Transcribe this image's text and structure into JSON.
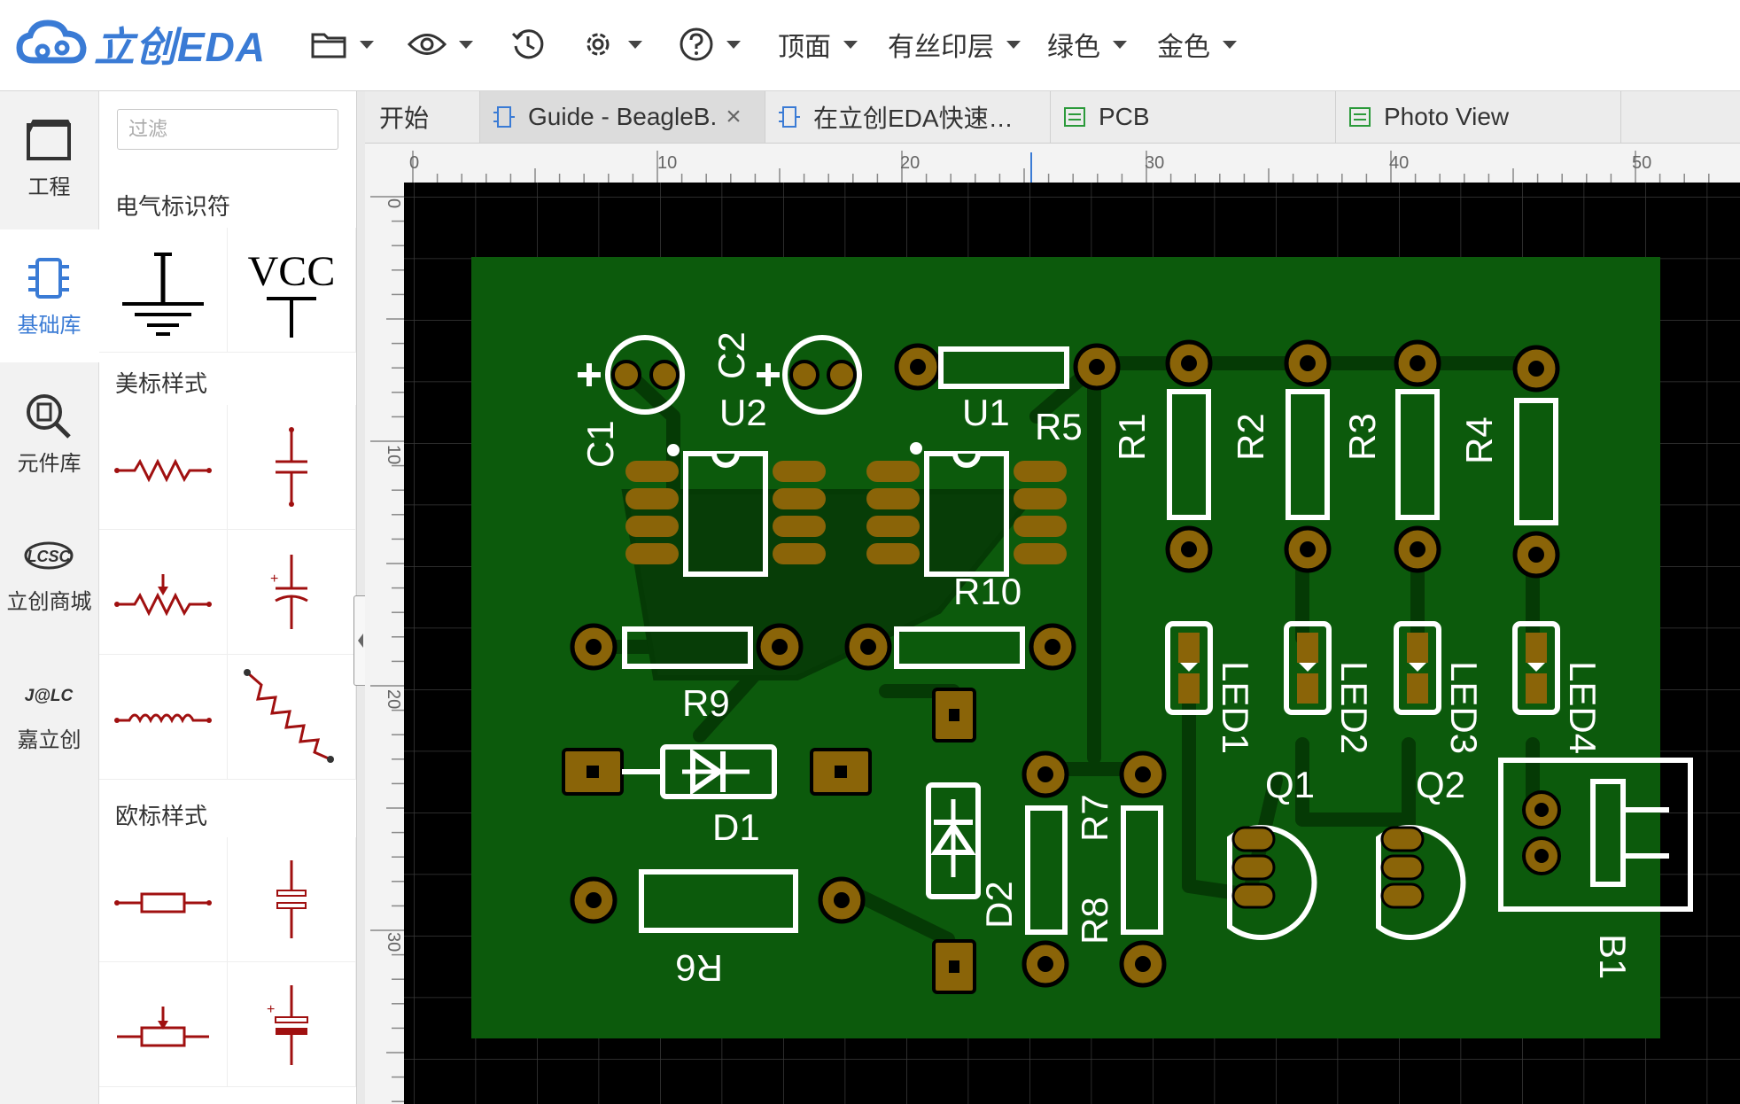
{
  "app": {
    "logo_text": "立创EDA"
  },
  "toolbar": {
    "icons": [
      "folder-icon",
      "eye-icon",
      "history-icon",
      "gear-icon",
      "help-icon"
    ],
    "layer_label": "顶面",
    "silk_label": "有丝印层",
    "board_color_label": "绿色",
    "finish_color_label": "金色"
  },
  "leftnav": {
    "items": [
      {
        "label": "工程",
        "icon": "project-icon"
      },
      {
        "label": "基础库",
        "icon": "chip-icon"
      },
      {
        "label": "元件库",
        "icon": "component-search-icon"
      },
      {
        "label": "立创商城",
        "icon": "lcsc-icon"
      },
      {
        "label": "嘉立创",
        "icon": "jlc-icon"
      }
    ],
    "logo_lcsc": "LCSC",
    "logo_jlc": "J@LC"
  },
  "library": {
    "filter_placeholder": "过滤",
    "sections": [
      "电气标识符",
      "美标样式",
      "欧标样式"
    ],
    "vcc_label": "VCC"
  },
  "tabs": [
    {
      "label": "开始"
    },
    {
      "label": "Guide - BeagleB.",
      "close": "×"
    },
    {
      "label": "在立创EDA快速…"
    },
    {
      "label": "PCB"
    },
    {
      "label": "Photo View"
    }
  ],
  "ruler": {
    "top_labels": [
      "0",
      "10",
      "20",
      "30",
      "40",
      "50"
    ],
    "left_labels": [
      "0",
      "10",
      "20",
      "30"
    ]
  },
  "colors": {
    "accent": "#3a7bd5",
    "board": "#0c5a0c",
    "copper": "#8a6408",
    "silk": "#ffffff",
    "canvas": "#000000",
    "grid": "#3a3a3a"
  },
  "pcb": {
    "silk_labels": [
      "C1",
      "C2",
      "U2",
      "U1",
      "R5",
      "R1",
      "R2",
      "R3",
      "R4",
      "R10",
      "R9",
      "D1",
      "D2",
      "R8",
      "R7",
      "R6",
      "LED1",
      "LED2",
      "LED3",
      "LED4",
      "Q1",
      "Q2",
      "B1"
    ]
  }
}
